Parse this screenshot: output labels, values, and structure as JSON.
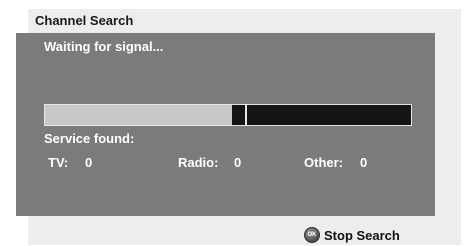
{
  "window": {
    "title": "Channel Search"
  },
  "panel": {
    "status": "Waiting for signal...",
    "progress": 0.51,
    "service_found_label": "Service found:",
    "counts": {
      "tv": {
        "label": "TV:",
        "value": "0"
      },
      "radio": {
        "label": "Radio:",
        "value": "0"
      },
      "other": {
        "label": "Other:",
        "value": "0"
      }
    }
  },
  "footer": {
    "ok_icon_text": "OK",
    "stop_label": "Stop Search"
  },
  "colors": {
    "panel": "#7b7b7b",
    "progress_track": "#151515",
    "progress_fill": "#c8c8c8"
  }
}
